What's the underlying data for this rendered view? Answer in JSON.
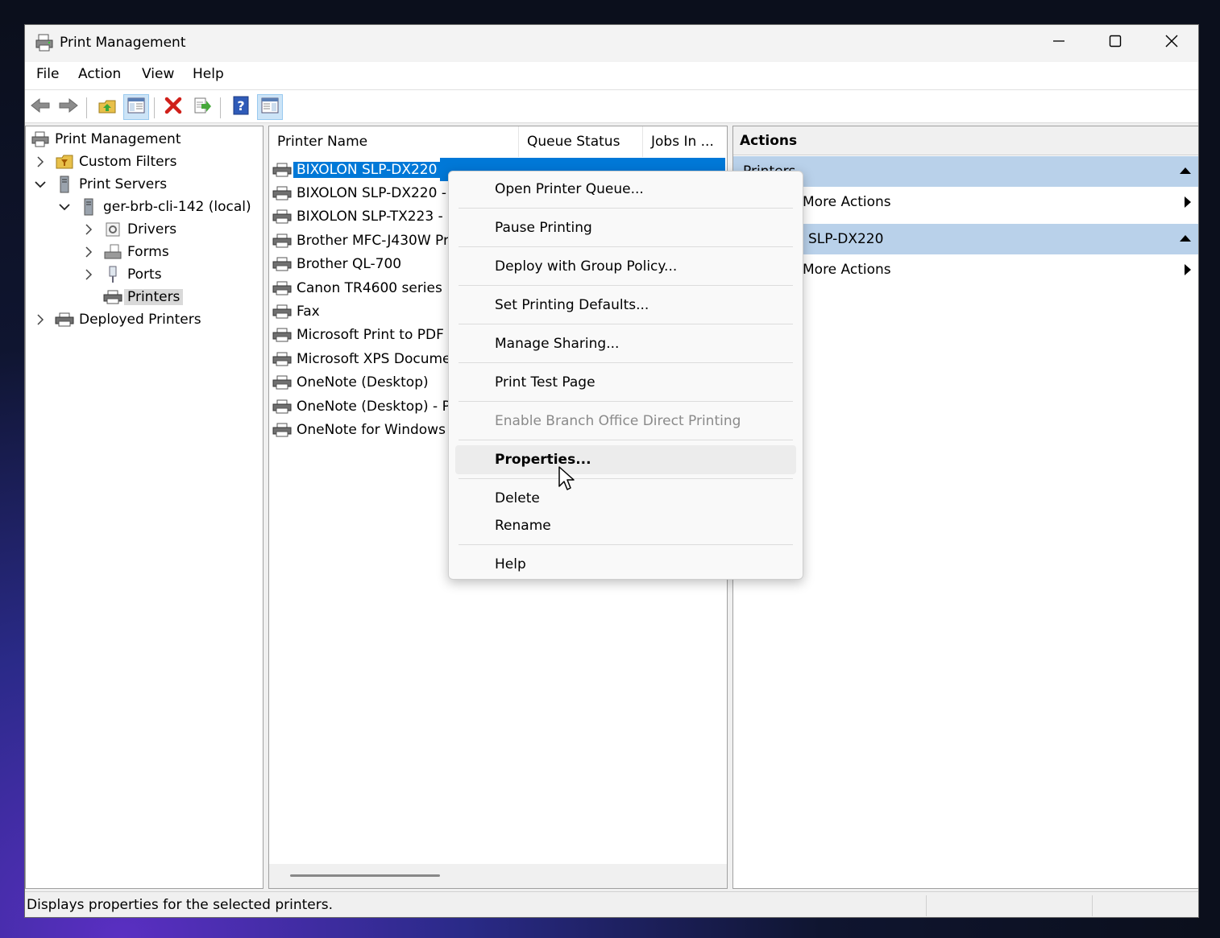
{
  "window": {
    "title": "Print Management"
  },
  "menu": [
    "File",
    "Action",
    "View",
    "Help"
  ],
  "toolbar": {
    "buttons": [
      "back-arrow-icon",
      "forward-arrow-icon",
      "up-folder-icon",
      "show-hide-tree-icon",
      "delete-icon",
      "export-list-icon",
      "help-icon",
      "show-hide-action-pane-icon"
    ]
  },
  "tree": {
    "root": "Print Management",
    "custom_filters": "Custom Filters",
    "print_servers": "Print Servers",
    "server": "ger-brb-cli-142 (local)",
    "drivers": "Drivers",
    "forms": "Forms",
    "ports": "Ports",
    "printers": "Printers",
    "deployed": "Deployed Printers"
  },
  "list": {
    "columns": [
      "Printer Name",
      "Queue Status",
      "Jobs In ..."
    ],
    "rows": [
      "BIXOLON SLP-DX220",
      "BIXOLON SLP-DX220 -",
      "BIXOLON SLP-TX223 -",
      "Brother MFC-J430W Pri",
      "Brother QL-700",
      "Canon TR4600 series",
      "Fax",
      "Microsoft Print to PDF",
      "Microsoft XPS Docume",
      "OneNote (Desktop)",
      "OneNote (Desktop) - P",
      "OneNote for Windows"
    ]
  },
  "actions": {
    "header": "Actions",
    "group1": "Printers",
    "group1_more": "More Actions",
    "group2": "BIXOLON SLP-DX220",
    "group2_more": "More Actions"
  },
  "context_menu": {
    "items": [
      "Open Printer Queue...",
      "Pause Printing",
      "Deploy with Group Policy...",
      "Set Printing Defaults...",
      "Manage Sharing...",
      "Print Test Page",
      "Enable Branch Office Direct Printing",
      "Properties...",
      "Delete",
      "Rename",
      "Help"
    ]
  },
  "status": {
    "text": "Displays properties for the selected printers."
  }
}
